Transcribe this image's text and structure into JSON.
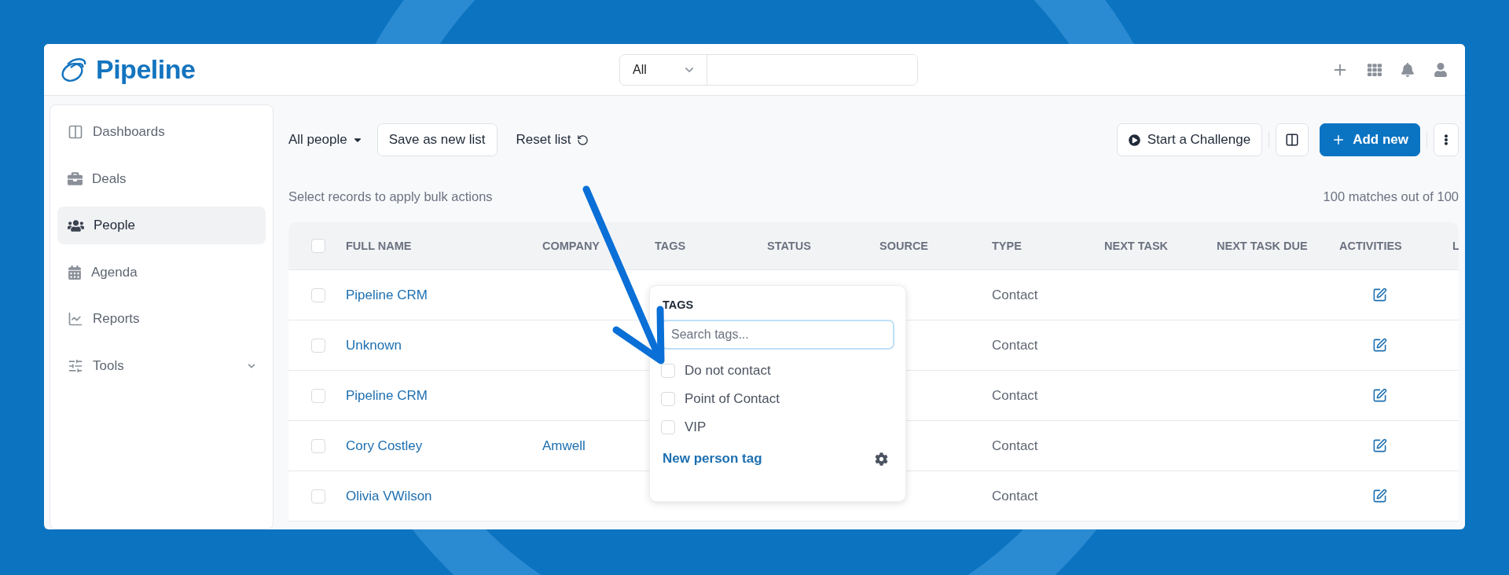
{
  "brand": {
    "name": "Pipeline"
  },
  "search": {
    "scope": "All"
  },
  "sidebar": {
    "items": [
      {
        "label": "Dashboards",
        "kind": "dashboards",
        "selected": false
      },
      {
        "label": "Deals",
        "kind": "deals",
        "selected": false
      },
      {
        "label": "People",
        "kind": "people",
        "selected": true
      },
      {
        "label": "Agenda",
        "kind": "agenda",
        "selected": false
      },
      {
        "label": "Reports",
        "kind": "reports",
        "selected": false
      },
      {
        "label": "Tools",
        "kind": "tools",
        "selected": false
      }
    ]
  },
  "toolbar": {
    "list_name": "All people",
    "save_button": "Save as new list",
    "reset_button": "Reset list",
    "challenge_button": "Start a Challenge",
    "add_button": "Add new"
  },
  "bulk_hint": "Select records to apply bulk actions",
  "match_count": "100 matches out of 100",
  "table": {
    "all_checked": false,
    "columns": [
      "FULL NAME",
      "COMPANY",
      "TAGS",
      "STATUS",
      "SOURCE",
      "TYPE",
      "NEXT TASK",
      "NEXT TASK DUE",
      "ACTIVITIES",
      "L"
    ],
    "rows": [
      {
        "full_name": "Pipeline CRM",
        "type": "Contact",
        "checked": false
      },
      {
        "full_name": "Unknown",
        "type": "Contact",
        "checked": false
      },
      {
        "full_name": "Pipeline CRM",
        "type": "Contact",
        "checked": false
      },
      {
        "full_name": "Cory Costley",
        "company": "Amwell",
        "type": "Contact",
        "checked": false
      },
      {
        "full_name": "Olivia VWilson",
        "type": "Contact",
        "checked": false
      }
    ]
  },
  "tags_popover": {
    "title": "TAGS",
    "search_placeholder": "Search tags...",
    "options": [
      {
        "label": "Do not contact",
        "checked": false
      },
      {
        "label": "Point of Contact",
        "checked": false
      },
      {
        "label": "VIP",
        "checked": false
      }
    ],
    "new_tag_link": "New person tag"
  }
}
